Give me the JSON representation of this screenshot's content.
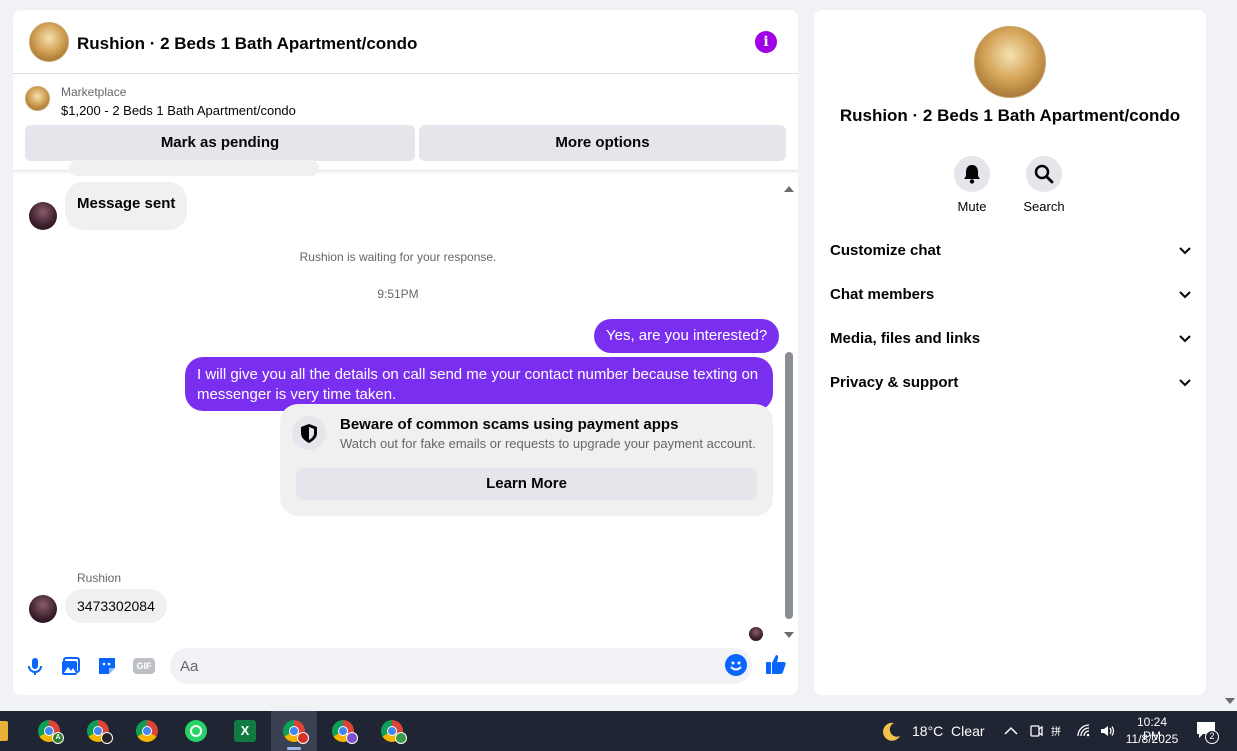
{
  "chat": {
    "title": "Rushion · 2 Beds 1 Bath Apartment/condo",
    "listing": {
      "source": "Marketplace",
      "description": "$1,200 - 2 Beds 1 Bath Apartment/condo",
      "mark_pending_label": "Mark as pending",
      "more_options_label": "More options"
    },
    "messages": {
      "first_in": "Message sent",
      "waiting": "Rushion is waiting for your response.",
      "timestamp": "9:51PM",
      "out_1": "Yes, are you interested?",
      "out_2": "I will give you all the details on call send me your contact number because texting on messenger is very time taken.",
      "scam_title": "Beware of common scams using payment apps",
      "scam_sub": "Watch out for fake emails or requests to upgrade your payment account.",
      "learn_more_label": "Learn More",
      "sender_name": "Rushion",
      "last_in": "3473302084"
    },
    "composer": {
      "placeholder": "Aa",
      "gif_label": "GIF"
    }
  },
  "right_panel": {
    "title": "Rushion · 2 Beds 1 Bath Apartment/condo",
    "actions": {
      "mute": "Mute",
      "search": "Search"
    },
    "sections": [
      "Customize chat",
      "Chat members",
      "Media, files and links",
      "Privacy & support"
    ]
  },
  "taskbar": {
    "weather": "18°C  Clear",
    "time": "10:24 PM",
    "date": "11/8/2025",
    "notifications": "2",
    "profile_badge_a": "A"
  },
  "colors": {
    "accent_purple": "#7a2ff0",
    "info_icon": "#a000e6",
    "messenger_blue": "#0866ff"
  }
}
